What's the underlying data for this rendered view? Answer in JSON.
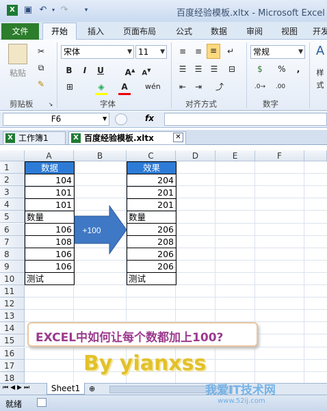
{
  "window": {
    "title": "百度经验模板.xltx - Microsoft Excel"
  },
  "ribbon_tabs": [
    "文件",
    "开始",
    "插入",
    "页面布局",
    "公式",
    "数据",
    "审阅",
    "视图",
    "开发"
  ],
  "ribbon": {
    "paste_label": "粘贴",
    "font_name": "宋体",
    "font_size": "11",
    "number_format": "常规",
    "groups": {
      "clipboard": "剪贴板",
      "font": "字体",
      "alignment": "对齐方式",
      "number": "数字"
    },
    "style_label": "样式"
  },
  "formula_bar": {
    "name_box": "F6",
    "fx": "fx",
    "formula": ""
  },
  "workbook_tabs": [
    "工作簿1",
    "百度经验模板.xltx"
  ],
  "grid": {
    "columns": [
      "A",
      "B",
      "C",
      "D",
      "E",
      "F"
    ],
    "rows": [
      "1",
      "2",
      "3",
      "4",
      "5",
      "6",
      "7",
      "8",
      "9",
      "10",
      "11",
      "12",
      "13",
      "14",
      "15",
      "16",
      "17",
      "18"
    ],
    "colA": [
      "数据",
      "104",
      "101",
      "101",
      "数量",
      "106",
      "108",
      "106",
      "106",
      "测试"
    ],
    "colC": [
      "效果",
      "204",
      "201",
      "201",
      "数量",
      "206",
      "208",
      "206",
      "206",
      "测试"
    ],
    "arrow_label": "+100"
  },
  "banner_text": "EXCEL中如何让每个数都加上100?",
  "byline": "By yianxss",
  "sheet_tab": "Sheet1",
  "status": {
    "ready": "就绪"
  },
  "watermark": {
    "main": "我爱IT技术网",
    "url": "www.52ij.com"
  },
  "colors": {
    "header_fill": "#2d7bd6",
    "arrow": "#3f78c4",
    "file_tab": "#2c7d2c"
  }
}
